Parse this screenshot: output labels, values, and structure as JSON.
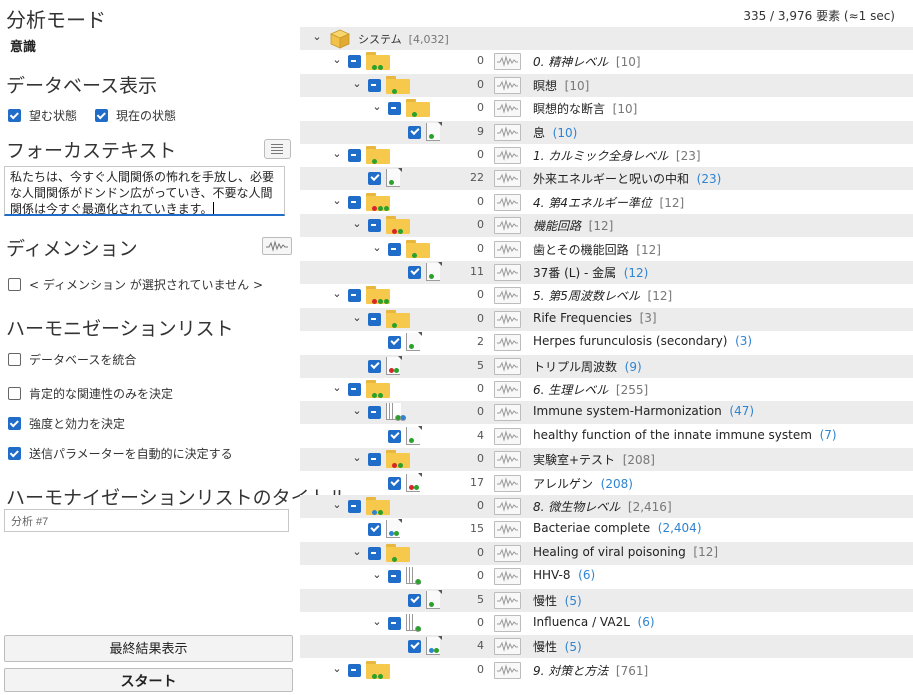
{
  "left": {
    "mode_title": "分析モード",
    "mode_value": "意識",
    "db_section": "データベース表示",
    "desired_state": "望む状態",
    "current_state": "現在の状態",
    "focus_title": "フォーカステキスト",
    "focus_text": "私たちは、今すぐ人間関係の怖れを手放し、必要な人間関係がドンドン広がっていき、不要な人間関係は今すぐ最適化されていきます。",
    "dimension_title": "ディメンション",
    "no_dimension": "< ディメンション が選択されていません >",
    "harmonization_title": "ハーモニゼーションリスト",
    "opt_merge_db": "データベースを統合",
    "opt_positive_only": "肯定的な関連性のみを決定",
    "opt_strength": "強度と効力を決定",
    "opt_auto_params": "送信パラメーターを自動的に決定する",
    "list_title_heading": "ハーモナイゼーションリストのタイトル",
    "list_title_value": "分析 #7",
    "final_results_button": "最終結果表示",
    "start_button": "スタート"
  },
  "checks": {
    "desired_state": true,
    "current_state": true,
    "no_dimension": false,
    "opt_merge_db": false,
    "opt_positive_only": false,
    "opt_strength": true,
    "opt_auto_params": true
  },
  "header": {
    "count_text": "335 / 3,976 要素 (≈1 sec)"
  },
  "tree": {
    "root_label": "システム",
    "root_count": "[4,032]",
    "rows": [
      {
        "level": 1,
        "kind": "folder",
        "cb": "partial",
        "num": "0",
        "text": "0. 精神レベル",
        "count": "[10]",
        "italic": true,
        "dots": [
          "#2ca02c",
          "#2ca02c"
        ]
      },
      {
        "level": 2,
        "kind": "folder",
        "cb": "partial",
        "num": "0",
        "text": "瞑想",
        "count": "[10]",
        "italic": false,
        "dots": [
          "#2ca02c"
        ]
      },
      {
        "level": 3,
        "kind": "folder",
        "cb": "partial",
        "num": "0",
        "text": "瞑想的な断言",
        "count": "[10]",
        "italic": false,
        "dots": [
          "#2ca02c"
        ]
      },
      {
        "level": 4,
        "kind": "doc",
        "cb": "full",
        "num": "9",
        "text": "息",
        "count": "(10)",
        "italic": false,
        "dots": [
          "#2ca02c"
        ]
      },
      {
        "level": 1,
        "kind": "folder",
        "cb": "partial",
        "num": "0",
        "text": "1. カルミック全身レベル",
        "count": "[23]",
        "italic": true,
        "dots": [
          "#2ca02c"
        ]
      },
      {
        "level": 2,
        "kind": "doc",
        "cb": "full",
        "num": "22",
        "text": "外来エネルギーと呪いの中和",
        "count": "(23)",
        "italic": false,
        "dots": [
          "#2ca02c"
        ]
      },
      {
        "level": 1,
        "kind": "folder",
        "cb": "partial",
        "num": "0",
        "text": "4. 第4エネルギー準位",
        "count": "[12]",
        "italic": true,
        "dots": [
          "#d62728",
          "#2ca02c",
          "#2ca02c"
        ]
      },
      {
        "level": 2,
        "kind": "folder",
        "cb": "partial",
        "num": "0",
        "text": "機能回路",
        "count": "[12]",
        "italic": true,
        "dots": [
          "#d62728",
          "#2ca02c"
        ]
      },
      {
        "level": 3,
        "kind": "folder",
        "cb": "partial",
        "num": "0",
        "text": "歯とその機能回路",
        "count": "[12]",
        "italic": false,
        "dots": [
          "#2ca02c"
        ]
      },
      {
        "level": 4,
        "kind": "doc",
        "cb": "full",
        "num": "11",
        "text": "37番 (L) - 金属",
        "count": "(12)",
        "italic": false,
        "dots": [
          "#2ca02c"
        ]
      },
      {
        "level": 1,
        "kind": "folder",
        "cb": "partial",
        "num": "0",
        "text": "5. 第5周波数レベル",
        "count": "[12]",
        "italic": true,
        "dots": [
          "#d62728",
          "#2ca02c",
          "#2ca02c"
        ]
      },
      {
        "level": 2,
        "kind": "folder",
        "cb": "partial",
        "num": "0",
        "text": "Rife Frequencies",
        "count": "[3]",
        "italic": false,
        "dots": [
          "#2ca02c"
        ]
      },
      {
        "level": 3,
        "kind": "doc",
        "cb": "full",
        "num": "2",
        "text": "Herpes furunculosis (secondary)",
        "count": "(3)",
        "italic": false,
        "dots": [
          "#2ca02c"
        ]
      },
      {
        "level": 2,
        "kind": "doc",
        "cb": "full",
        "num": "5",
        "text": "トリプル周波数",
        "count": "(9)",
        "italic": false,
        "dots": [
          "#d62728",
          "#2ca02c"
        ]
      },
      {
        "level": 1,
        "kind": "folder",
        "cb": "partial",
        "num": "0",
        "text": "6. 生理レベル",
        "count": "[255]",
        "italic": true,
        "dots": [
          "#2ca02c",
          "#2ca02c"
        ]
      },
      {
        "level": 2,
        "kind": "stack",
        "cb": "partial",
        "num": "0",
        "text": "Immune system-Harmonization",
        "count": "(47)",
        "italic": false,
        "dots": [
          "#2ca02c",
          "#2f84d0"
        ]
      },
      {
        "level": 3,
        "kind": "doc",
        "cb": "full",
        "num": "4",
        "text": "healthy function of the innate immune system",
        "count": "(7)",
        "italic": false,
        "dots": [
          "#2ca02c"
        ]
      },
      {
        "level": 2,
        "kind": "folder",
        "cb": "partial",
        "num": "0",
        "text": "実験室+テスト",
        "count": "[208]",
        "italic": false,
        "dots": [
          "#d62728",
          "#2ca02c"
        ]
      },
      {
        "level": 3,
        "kind": "doc",
        "cb": "full",
        "num": "17",
        "text": "アレルゲン",
        "count": "(208)",
        "italic": false,
        "dots": [
          "#d62728",
          "#2ca02c"
        ]
      },
      {
        "level": 1,
        "kind": "folder",
        "cb": "partial",
        "num": "0",
        "text": "8. 微生物レベル",
        "count": "[2,416]",
        "italic": true,
        "dots": [
          "#2f84d0",
          "#2ca02c"
        ]
      },
      {
        "level": 2,
        "kind": "doc",
        "cb": "full",
        "num": "15",
        "text": "Bacteriae complete",
        "count": "(2,404)",
        "italic": false,
        "dots": [
          "#2f84d0",
          "#2ca02c"
        ]
      },
      {
        "level": 2,
        "kind": "folder",
        "cb": "partial",
        "num": "0",
        "text": "Healing of viral poisoning",
        "count": "[12]",
        "italic": false,
        "dots": [
          "#2ca02c"
        ]
      },
      {
        "level": 3,
        "kind": "stack",
        "cb": "partial",
        "num": "0",
        "text": "HHV-8",
        "count": "(6)",
        "italic": false,
        "dots": [
          "#2ca02c"
        ]
      },
      {
        "level": 4,
        "kind": "doc",
        "cb": "full",
        "num": "5",
        "text": "慢性",
        "count": "(5)",
        "italic": false,
        "dots": [
          "#2ca02c"
        ]
      },
      {
        "level": 3,
        "kind": "stack",
        "cb": "partial",
        "num": "0",
        "text": "Influenca / VA2L",
        "count": "(6)",
        "italic": false,
        "dots": [
          "#2ca02c"
        ]
      },
      {
        "level": 4,
        "kind": "doc",
        "cb": "full",
        "num": "4",
        "text": "慢性",
        "count": "(5)",
        "italic": false,
        "dots": [
          "#2f84d0",
          "#2ca02c"
        ]
      },
      {
        "level": 1,
        "kind": "folder",
        "cb": "partial",
        "num": "0",
        "text": "9. 対策と方法",
        "count": "[761]",
        "italic": true,
        "dots": [
          "#2ca02c",
          "#2ca02c"
        ]
      }
    ]
  }
}
